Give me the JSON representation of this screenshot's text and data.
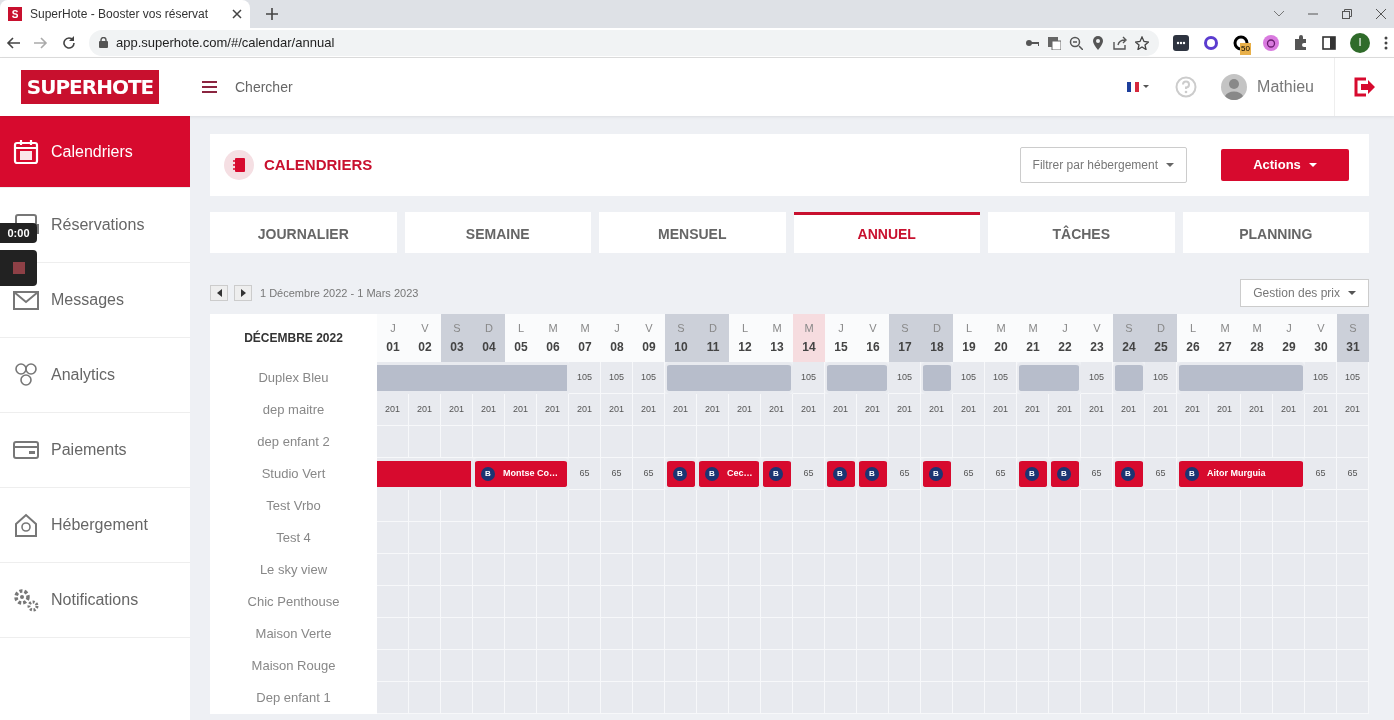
{
  "browser": {
    "tab": {
      "favicon": "S",
      "title": "SuperHote - Booster vos réservat"
    },
    "url": "app.superhote.com/#/calendar/annual",
    "extension_badge": "50",
    "profile": "I"
  },
  "header": {
    "logo": "SUPERHOTE",
    "search": "Chercher",
    "user": "Mathieu"
  },
  "sidebar": {
    "items": [
      {
        "label": "Calendriers",
        "selected": true
      },
      {
        "label": "Réservations",
        "selected": false
      },
      {
        "label": "Messages",
        "selected": false
      },
      {
        "label": "Analytics",
        "selected": false
      },
      {
        "label": "Paiements",
        "selected": false
      },
      {
        "label": "Hébergement",
        "selected": false
      },
      {
        "label": "Notifications",
        "selected": false
      }
    ]
  },
  "recorder": {
    "time": "0:00"
  },
  "page": {
    "title": "CALENDRIERS",
    "filter": "Filtrer par hébergement",
    "actions": "Actions"
  },
  "tabs": [
    {
      "label": "JOURNALIER",
      "selected": false
    },
    {
      "label": "SEMAINE",
      "selected": false
    },
    {
      "label": "MENSUEL",
      "selected": false
    },
    {
      "label": "ANNUEL",
      "selected": true
    },
    {
      "label": "TÂCHES",
      "selected": false
    },
    {
      "label": "PLANNING",
      "selected": false
    }
  ],
  "range": "1 Décembre 2022 - 1 Mars 2023",
  "price_menu": "Gestion des prix",
  "calendar": {
    "month": "DÉCEMBRE 2022",
    "days": [
      {
        "letter": "J",
        "number": "01",
        "weekend": false,
        "today": false
      },
      {
        "letter": "V",
        "number": "02",
        "weekend": false,
        "today": false
      },
      {
        "letter": "S",
        "number": "03",
        "weekend": true,
        "today": false
      },
      {
        "letter": "D",
        "number": "04",
        "weekend": true,
        "today": false
      },
      {
        "letter": "L",
        "number": "05",
        "weekend": false,
        "today": false
      },
      {
        "letter": "M",
        "number": "06",
        "weekend": false,
        "today": false
      },
      {
        "letter": "M",
        "number": "07",
        "weekend": false,
        "today": false
      },
      {
        "letter": "J",
        "number": "08",
        "weekend": false,
        "today": false
      },
      {
        "letter": "V",
        "number": "09",
        "weekend": false,
        "today": false
      },
      {
        "letter": "S",
        "number": "10",
        "weekend": true,
        "today": false
      },
      {
        "letter": "D",
        "number": "11",
        "weekend": true,
        "today": false
      },
      {
        "letter": "L",
        "number": "12",
        "weekend": false,
        "today": false
      },
      {
        "letter": "M",
        "number": "13",
        "weekend": false,
        "today": false
      },
      {
        "letter": "M",
        "number": "14",
        "weekend": false,
        "today": true
      },
      {
        "letter": "J",
        "number": "15",
        "weekend": false,
        "today": false
      },
      {
        "letter": "V",
        "number": "16",
        "weekend": false,
        "today": false
      },
      {
        "letter": "S",
        "number": "17",
        "weekend": true,
        "today": false
      },
      {
        "letter": "D",
        "number": "18",
        "weekend": true,
        "today": false
      },
      {
        "letter": "L",
        "number": "19",
        "weekend": false,
        "today": false
      },
      {
        "letter": "M",
        "number": "20",
        "weekend": false,
        "today": false
      },
      {
        "letter": "M",
        "number": "21",
        "weekend": false,
        "today": false
      },
      {
        "letter": "J",
        "number": "22",
        "weekend": false,
        "today": false
      },
      {
        "letter": "V",
        "number": "23",
        "weekend": false,
        "today": false
      },
      {
        "letter": "S",
        "number": "24",
        "weekend": true,
        "today": false
      },
      {
        "letter": "D",
        "number": "25",
        "weekend": true,
        "today": false
      },
      {
        "letter": "L",
        "number": "26",
        "weekend": false,
        "today": false
      },
      {
        "letter": "M",
        "number": "27",
        "weekend": false,
        "today": false
      },
      {
        "letter": "M",
        "number": "28",
        "weekend": false,
        "today": false
      },
      {
        "letter": "J",
        "number": "29",
        "weekend": false,
        "today": false
      },
      {
        "letter": "V",
        "number": "30",
        "weekend": false,
        "today": false
      },
      {
        "letter": "S",
        "number": "31",
        "weekend": true,
        "today": false
      }
    ],
    "rows": [
      {
        "name": "Duplex Bleu",
        "cells": [
          {
            "kind": "blocked"
          },
          {
            "kind": "continued"
          },
          {
            "kind": "continued"
          },
          {
            "kind": "continued"
          },
          {
            "kind": "continued"
          },
          {
            "kind": "continued"
          },
          {
            "kind": "price",
            "text": "105"
          },
          {
            "kind": "price",
            "text": "105"
          },
          {
            "kind": "price",
            "text": "105"
          },
          {
            "kind": "blocked"
          },
          {
            "kind": "continued"
          },
          {
            "kind": "continued"
          },
          {
            "kind": "continued"
          },
          {
            "kind": "price",
            "text": "105"
          },
          {
            "kind": "blocked"
          },
          {
            "kind": "continued"
          },
          {
            "kind": "price",
            "text": "105"
          },
          {
            "kind": "blocked"
          },
          {
            "kind": "price",
            "text": "105"
          },
          {
            "kind": "price",
            "text": "105"
          },
          {
            "kind": "blocked"
          },
          {
            "kind": "continued"
          },
          {
            "kind": "price",
            "text": "105"
          },
          {
            "kind": "blocked"
          },
          {
            "kind": "price",
            "text": "105"
          },
          {
            "kind": "blocked"
          },
          {
            "kind": "continued"
          },
          {
            "kind": "continued"
          },
          {
            "kind": "continued"
          },
          {
            "kind": "price",
            "text": "105"
          },
          {
            "kind": "price",
            "text": "105"
          }
        ]
      },
      {
        "name": "dep maitre",
        "cells": [
          {
            "kind": "price",
            "text": "201"
          },
          {
            "kind": "price",
            "text": "201"
          },
          {
            "kind": "price",
            "text": "201"
          },
          {
            "kind": "price",
            "text": "201"
          },
          {
            "kind": "price",
            "text": "201"
          },
          {
            "kind": "price",
            "text": "201"
          },
          {
            "kind": "price",
            "text": "201"
          },
          {
            "kind": "price",
            "text": "201"
          },
          {
            "kind": "price",
            "text": "201"
          },
          {
            "kind": "price",
            "text": "201"
          },
          {
            "kind": "price",
            "text": "201"
          },
          {
            "kind": "price",
            "text": "201"
          },
          {
            "kind": "price",
            "text": "201"
          },
          {
            "kind": "price",
            "text": "201"
          },
          {
            "kind": "price",
            "text": "201"
          },
          {
            "kind": "price",
            "text": "201"
          },
          {
            "kind": "price",
            "text": "201"
          },
          {
            "kind": "price",
            "text": "201"
          },
          {
            "kind": "price",
            "text": "201"
          },
          {
            "kind": "price",
            "text": "201"
          },
          {
            "kind": "price",
            "text": "201"
          },
          {
            "kind": "price",
            "text": "201"
          },
          {
            "kind": "price",
            "text": "201"
          },
          {
            "kind": "price",
            "text": "201"
          },
          {
            "kind": "price",
            "text": "201"
          },
          {
            "kind": "price",
            "text": "201"
          },
          {
            "kind": "price",
            "text": "201"
          },
          {
            "kind": "price",
            "text": "201"
          },
          {
            "kind": "price",
            "text": "201"
          },
          {
            "kind": "price",
            "text": "201"
          },
          {
            "kind": "price",
            "text": "201"
          }
        ]
      },
      {
        "name": "dep enfant 2"
      },
      {
        "name": "Studio Vert",
        "cells": [
          {
            "kind": "booking"
          },
          {
            "kind": "continued"
          },
          {
            "kind": "continued"
          },
          {
            "kind": "booking",
            "badge": "B",
            "guest": "Montse Co…"
          },
          {
            "kind": "continued"
          },
          {
            "kind": "continued"
          },
          {
            "kind": "price",
            "text": "65"
          },
          {
            "kind": "price",
            "text": "65"
          },
          {
            "kind": "price",
            "text": "65"
          },
          {
            "kind": "booking",
            "badge": "B"
          },
          {
            "kind": "booking",
            "badge": "B",
            "guest": "Cec…"
          },
          {
            "kind": "continued"
          },
          {
            "kind": "booking",
            "badge": "B"
          },
          {
            "kind": "price",
            "text": "65"
          },
          {
            "kind": "booking",
            "badge": "B"
          },
          {
            "kind": "booking",
            "badge": "B"
          },
          {
            "kind": "price",
            "text": "65"
          },
          {
            "kind": "booking",
            "badge": "B"
          },
          {
            "kind": "price",
            "text": "65"
          },
          {
            "kind": "price",
            "text": "65"
          },
          {
            "kind": "booking",
            "badge": "B"
          },
          {
            "kind": "booking",
            "badge": "B"
          },
          {
            "kind": "price",
            "text": "65"
          },
          {
            "kind": "booking",
            "badge": "B"
          },
          {
            "kind": "price",
            "text": "65"
          },
          {
            "kind": "booking",
            "badge": "B",
            "guest": "Aitor Murguia"
          },
          {
            "kind": "continued"
          },
          {
            "kind": "continued"
          },
          {
            "kind": "continued"
          },
          {
            "kind": "price",
            "text": "65"
          },
          {
            "kind": "price",
            "text": "65"
          }
        ]
      },
      {
        "name": "Test Vrbo"
      },
      {
        "name": "Test 4"
      },
      {
        "name": "Le sky view"
      },
      {
        "name": "Chic Penthouse"
      },
      {
        "name": "Maison Verte"
      },
      {
        "name": "Maison Rouge"
      },
      {
        "name": "Dep enfant 1"
      }
    ]
  }
}
